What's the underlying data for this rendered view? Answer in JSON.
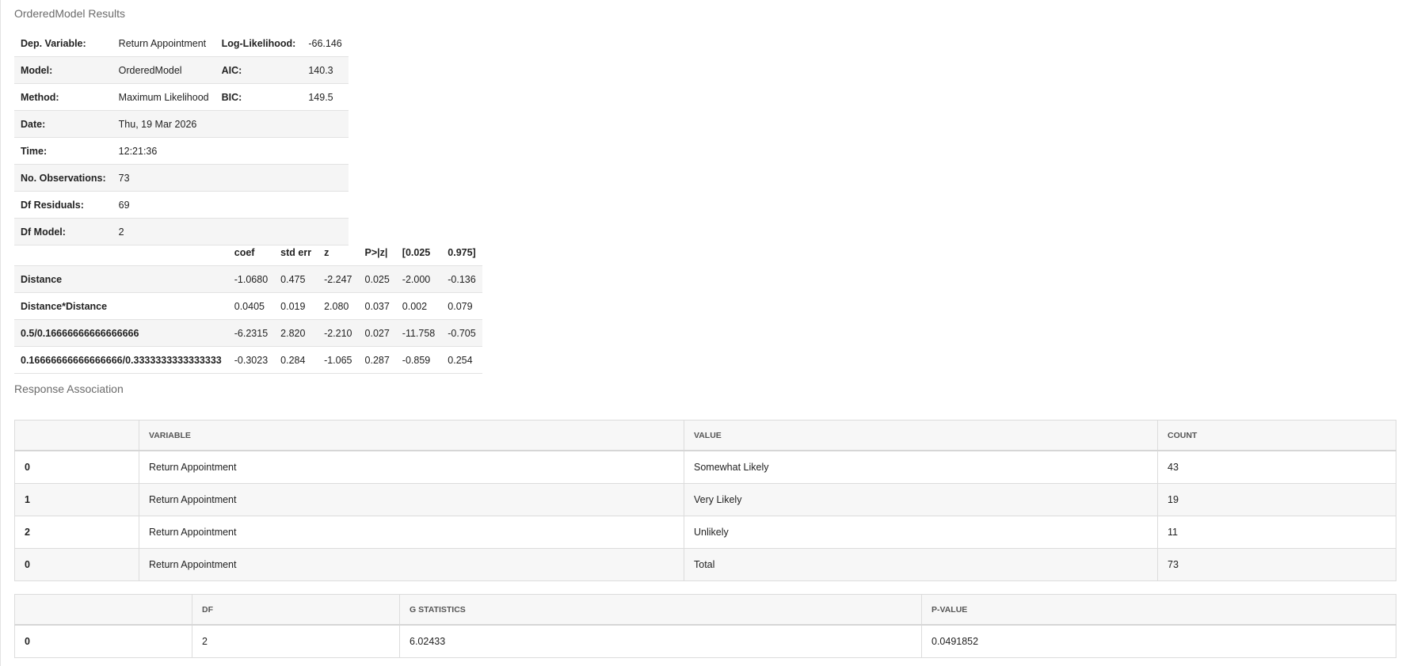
{
  "results_title": "OrderedModel Results",
  "summary": {
    "rows": [
      {
        "l1": "Dep. Variable:",
        "v1": "Return Appointment",
        "l2": "Log-Likelihood:",
        "v2": "-66.146"
      },
      {
        "l1": "Model:",
        "v1": "OrderedModel",
        "l2": "AIC:",
        "v2": "140.3"
      },
      {
        "l1": "Method:",
        "v1": "Maximum Likelihood",
        "l2": "BIC:",
        "v2": "149.5"
      },
      {
        "l1": "Date:",
        "v1": "Thu, 19 Mar 2026",
        "l2": "",
        "v2": ""
      },
      {
        "l1": "Time:",
        "v1": "12:21:36",
        "l2": "",
        "v2": ""
      },
      {
        "l1": "No. Observations:",
        "v1": "73",
        "l2": "",
        "v2": ""
      },
      {
        "l1": "Df Residuals:",
        "v1": "69",
        "l2": "",
        "v2": ""
      },
      {
        "l1": "Df Model:",
        "v1": "2",
        "l2": "",
        "v2": ""
      }
    ]
  },
  "coef_table": {
    "headers": [
      "",
      "coef",
      "std err",
      "z",
      "P>|z|",
      "[0.025",
      "0.975]"
    ],
    "rows": [
      [
        "Distance",
        "-1.0680",
        "0.475",
        "-2.247",
        "0.025",
        "-2.000",
        "-0.136"
      ],
      [
        "Distance*Distance",
        "0.0405",
        "0.019",
        "2.080",
        "0.037",
        "0.002",
        "0.079"
      ],
      [
        "0.5/0.16666666666666666",
        "-6.2315",
        "2.820",
        "-2.210",
        "0.027",
        "-11.758",
        "-0.705"
      ],
      [
        "0.16666666666666666/0.3333333333333333",
        "-0.3023",
        "0.284",
        "-1.065",
        "0.287",
        "-0.859",
        "0.254"
      ]
    ]
  },
  "association_title": "Response Association",
  "association_table": {
    "headers": [
      "",
      "VARIABLE",
      "VALUE",
      "COUNT"
    ],
    "rows": [
      [
        "0",
        "Return Appointment",
        "Somewhat Likely",
        "43"
      ],
      [
        "1",
        "Return Appointment",
        "Very Likely",
        "19"
      ],
      [
        "2",
        "Return Appointment",
        "Unlikely",
        "11"
      ],
      [
        "0",
        "Return Appointment",
        "Total",
        "73"
      ]
    ]
  },
  "stats_table": {
    "headers": [
      "",
      "DF",
      "G STATISTICS",
      "P-VALUE"
    ],
    "rows": [
      [
        "0",
        "2",
        "6.02433",
        "0.0491852"
      ]
    ]
  },
  "colors": {
    "stripe": "#f5f5f5",
    "border": "#dcdcdc",
    "title_text": "#6b6b6b"
  }
}
